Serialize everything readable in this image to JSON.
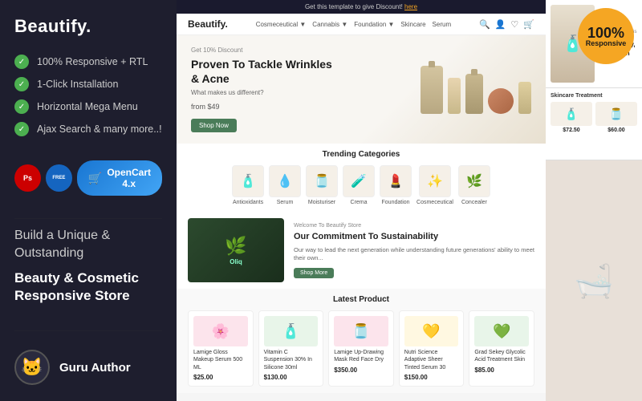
{
  "sidebar": {
    "title": "Beautify.",
    "features": [
      {
        "id": "responsive",
        "text": "100% Responsive + RTL"
      },
      {
        "id": "click",
        "text": "1-Click Installation"
      },
      {
        "id": "menu",
        "text": "Horizontal Mega Menu"
      },
      {
        "id": "ajax",
        "text": "Ajax Search & many more..!"
      }
    ],
    "badge_ps": "Ps",
    "badge_free": "FREE",
    "opencart_label": "OpenCart 4.x",
    "build_text": "Build a Unique & Outstanding",
    "beauty_text": "Beauty & Cosmetic Responsive Store",
    "author_name": "Guru Author",
    "author_emoji": "🐱"
  },
  "responsive_badge": {
    "percent": "100%",
    "label": "Responsive"
  },
  "site": {
    "logo": "Beautify.",
    "nav_links": [
      "Cosmeceutical ▼",
      "Cannabis ▼",
      "Foundation ▼",
      "Skincare",
      "Serum"
    ],
    "promo_text": "Get this template to give Discount!",
    "promo_link": "here"
  },
  "hero": {
    "tag": "Get 10% Discount",
    "title": "Proven To Tackle Wrinkles & Acne",
    "subtitle": "What makes us different?",
    "price_text": "from $49",
    "shop_btn": "Shop Now"
  },
  "trending": {
    "title": "Trending Categories",
    "categories": [
      {
        "label": "Antioxidants",
        "emoji": "🧴"
      },
      {
        "label": "Serum",
        "emoji": "💧"
      },
      {
        "label": "Moisturiser",
        "emoji": "🫙"
      },
      {
        "label": "Crema",
        "emoji": "🧪"
      },
      {
        "label": "Foundation",
        "emoji": "💄"
      },
      {
        "label": "Cosmeceutical",
        "emoji": "✨"
      },
      {
        "label": "Concealer",
        "emoji": "🌿"
      }
    ]
  },
  "sustainability": {
    "tag": "Welcome To Beautify Store",
    "title": "Our Commitment To Sustainability",
    "desc": "Our way to lead the next generation while understanding future generations' ability to meet their own...",
    "btn": "Shop More"
  },
  "latest": {
    "title": "Latest Product",
    "products": [
      {
        "name": "Lamige Gloss Makeup Serum 500 ML",
        "price": "$25.00",
        "emoji": "🌸"
      },
      {
        "name": "Vitamin C Suspension 30% In Silicone 30ml",
        "price": "$130.00",
        "emoji": "🧴"
      },
      {
        "name": "Lamige Up-Drawing Mask Red Face Dry",
        "price": "$350.00",
        "emoji": "🫙"
      },
      {
        "name": "Nutri Science Adaptive Sheer Tinted Serum 30",
        "price": "$150.00",
        "emoji": "💛"
      },
      {
        "name": "Grad Sekey Glycolic Acid Treatment Skin",
        "price": "$85.00",
        "emoji": "💚"
      }
    ]
  },
  "right_panel": {
    "promo_tag": "15% Off Only This Week",
    "promo_title": "Prevent Dry, Flaky Skin",
    "skincare_title": "Skincare Treatment",
    "mini_products": [
      {
        "emoji": "🧴",
        "price": "$72.50"
      },
      {
        "emoji": "🫙",
        "price": "$60.00"
      }
    ],
    "bottom_emoji": "🛁"
  }
}
